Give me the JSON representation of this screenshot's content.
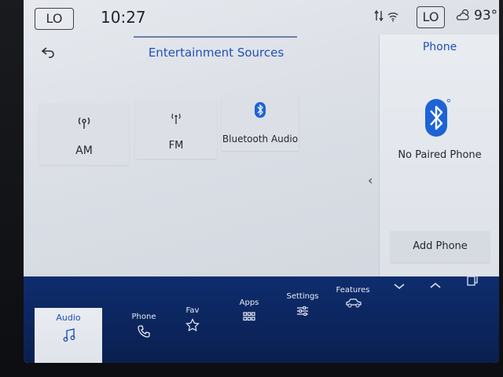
{
  "status_bar": {
    "climate_left": "LO",
    "time": "10:27",
    "climate_right": "LO",
    "temperature": "93°",
    "icons": [
      "data-transfer-icon",
      "wifi-icon",
      "weather-icon"
    ]
  },
  "main": {
    "title": "Entertainment Sources",
    "sources": [
      {
        "label": "AM",
        "icon": "am-antenna-icon"
      },
      {
        "label": "FM",
        "icon": "fm-antenna-icon"
      },
      {
        "label": "Bluetooth Audio",
        "icon": "bluetooth-icon"
      }
    ]
  },
  "phone_panel": {
    "title": "Phone",
    "status": "No Paired Phone",
    "add_button": "Add Phone"
  },
  "nav": {
    "items": [
      {
        "label": "Audio",
        "icon": "music-note-icon",
        "active": true
      },
      {
        "label": "Phone",
        "icon": "phone-icon"
      },
      {
        "label": "Fav",
        "icon": "star-icon"
      },
      {
        "label": "Apps",
        "icon": "apps-grid-icon"
      },
      {
        "label": "Settings",
        "icon": "sliders-icon"
      },
      {
        "label": "Features",
        "icon": "truck-icon"
      }
    ]
  },
  "colors": {
    "accent": "#1f4fb8",
    "nav_bg": "#0e2d6e",
    "bluetooth": "#1d63d6",
    "active_underline": "#59c6d9"
  }
}
